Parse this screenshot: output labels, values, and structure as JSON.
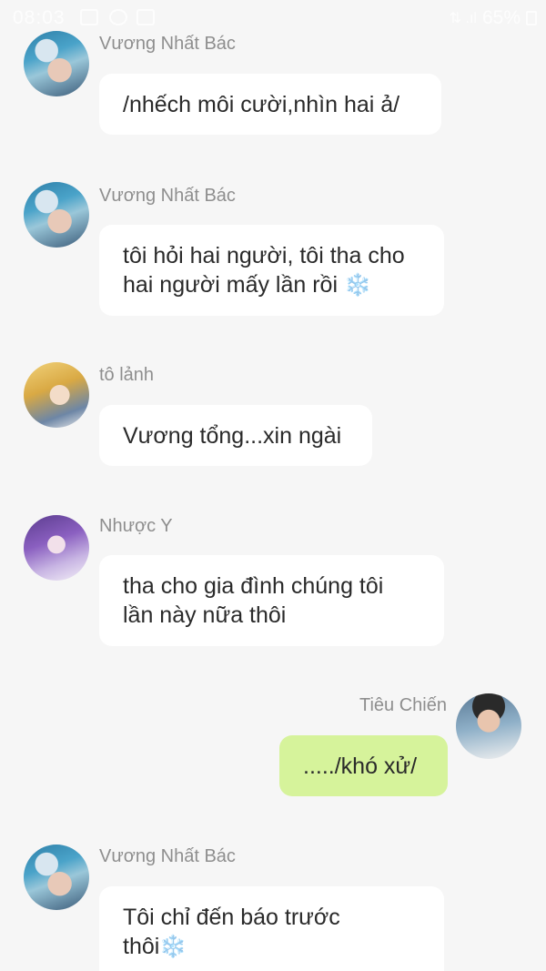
{
  "status_bar": {
    "time": "08:03",
    "signal": "⇅ .ıl",
    "battery": "65%"
  },
  "messages": [
    {
      "sender": "Vương Nhất Bác",
      "lines": [
        "/nhếch môi cười,nhìn hai ả/"
      ],
      "avatar": "avatar-vuong-nhat-bac"
    },
    {
      "sender": "Vương Nhất Bác",
      "lines": [
        "tôi hỏi hai người, tôi tha cho",
        "hai người mấy lần rồi"
      ],
      "emoji": "❄️",
      "avatar": "avatar-vuong-nhat-bac"
    },
    {
      "sender": "tô lảnh",
      "lines": [
        "Vương tổng...xin ngài"
      ],
      "avatar": "avatar-to-lanh"
    },
    {
      "sender": "Nhược Y",
      "lines": [
        "tha cho gia đình chúng tôi",
        "lần này nữa thôi"
      ],
      "avatar": "avatar-nhuoc-y"
    },
    {
      "sender": "Tiêu Chiến",
      "lines": [
        "...../khó xử/"
      ],
      "avatar": "avatar-tieu-chien",
      "own": true
    },
    {
      "sender": "Vương Nhất Bác",
      "lines": [
        "Tôi chỉ đến báo trước",
        "thôi"
      ],
      "emoji": "❄️",
      "avatar": "avatar-vuong-nhat-bac"
    }
  ],
  "colors": {
    "background": "#f6f6f6",
    "incoming_bubble": "#ffffff",
    "outgoing_bubble": "#d6f39b",
    "sender_name": "#8e8e8e"
  }
}
